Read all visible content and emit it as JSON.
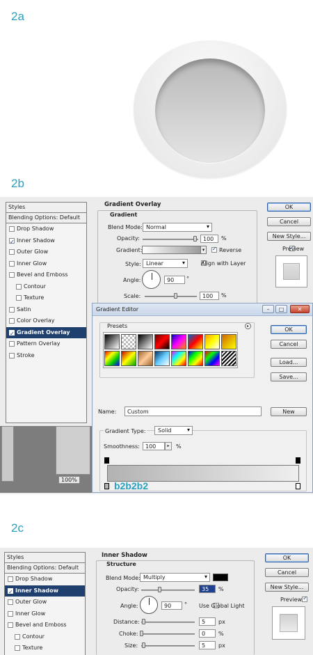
{
  "steps": {
    "a": "2a",
    "b": "2b",
    "c": "2c"
  },
  "panel_b": {
    "styles_header": "Styles",
    "blending_options": "Blending Options: Default",
    "items": [
      {
        "label": "Drop Shadow",
        "checked": false,
        "indent": false,
        "selected": false
      },
      {
        "label": "Inner Shadow",
        "checked": true,
        "indent": false,
        "selected": false
      },
      {
        "label": "Outer Glow",
        "checked": false,
        "indent": false,
        "selected": false
      },
      {
        "label": "Inner Glow",
        "checked": false,
        "indent": false,
        "selected": false
      },
      {
        "label": "Bevel and Emboss",
        "checked": false,
        "indent": false,
        "selected": false
      },
      {
        "label": "Contour",
        "checked": false,
        "indent": true,
        "selected": false
      },
      {
        "label": "Texture",
        "checked": false,
        "indent": true,
        "selected": false
      },
      {
        "label": "Satin",
        "checked": false,
        "indent": false,
        "selected": false
      },
      {
        "label": "Color Overlay",
        "checked": false,
        "indent": false,
        "selected": false
      },
      {
        "label": "Gradient Overlay",
        "checked": true,
        "indent": false,
        "selected": true
      },
      {
        "label": "Pattern Overlay",
        "checked": false,
        "indent": false,
        "selected": false
      },
      {
        "label": "Stroke",
        "checked": false,
        "indent": false,
        "selected": false
      }
    ],
    "section_title": "Gradient Overlay",
    "group_title": "Gradient",
    "blend_mode_label": "Blend Mode:",
    "blend_mode_value": "Normal",
    "opacity_label": "Opacity:",
    "opacity_value": "100",
    "opacity_unit": "%",
    "gradient_label": "Gradient:",
    "reverse_label": "Reverse",
    "style_label": "Style:",
    "style_value": "Linear",
    "align_label": "Align with Layer",
    "angle_label": "Angle:",
    "angle_value": "90",
    "angle_unit": "°",
    "scale_label": "Scale:",
    "scale_value": "100",
    "scale_unit": "%",
    "ok": "OK",
    "cancel": "Cancel",
    "new_style": "New Style...",
    "preview": "Preview",
    "zoom": "100%"
  },
  "gradient_editor": {
    "title": "Gradient Editor",
    "presets": "Presets",
    "ok": "OK",
    "cancel": "Cancel",
    "load": "Load...",
    "save": "Save...",
    "name_label": "Name:",
    "name_value": "Custom",
    "new": "New",
    "type_label": "Gradient Type:",
    "type_value": "Solid",
    "smoothness_label": "Smoothness:",
    "smoothness_value": "100",
    "smoothness_unit": "%",
    "stop_color_note": "b2b2b2",
    "gradient_start": "#b2b2b2",
    "gradient_end": "#efefef"
  },
  "panel_c": {
    "styles_header": "Styles",
    "blending_options": "Blending Options: Default",
    "items": [
      {
        "label": "Drop Shadow",
        "checked": false,
        "indent": false,
        "selected": false
      },
      {
        "label": "Inner Shadow",
        "checked": true,
        "indent": false,
        "selected": true
      },
      {
        "label": "Outer Glow",
        "checked": false,
        "indent": false,
        "selected": false
      },
      {
        "label": "Inner Glow",
        "checked": false,
        "indent": false,
        "selected": false
      },
      {
        "label": "Bevel and Emboss",
        "checked": false,
        "indent": false,
        "selected": false
      },
      {
        "label": "Contour",
        "checked": false,
        "indent": true,
        "selected": false
      },
      {
        "label": "Texture",
        "checked": false,
        "indent": true,
        "selected": false
      }
    ],
    "section_title": "Inner Shadow",
    "group_title": "Structure",
    "blend_mode_label": "Blend Mode:",
    "blend_mode_value": "Multiply",
    "opacity_label": "Opacity:",
    "opacity_value": "35",
    "opacity_unit": "%",
    "angle_label": "Angle:",
    "angle_value": "90",
    "angle_unit": "°",
    "global_light_label": "Use Global Light",
    "distance_label": "Distance:",
    "distance_value": "5",
    "distance_unit": "px",
    "choke_label": "Choke:",
    "choke_value": "0",
    "choke_unit": "%",
    "size_label": "Size:",
    "size_value": "5",
    "size_unit": "px",
    "ok": "OK",
    "cancel": "Cancel",
    "new_style": "New Style...",
    "preview": "Preview"
  }
}
